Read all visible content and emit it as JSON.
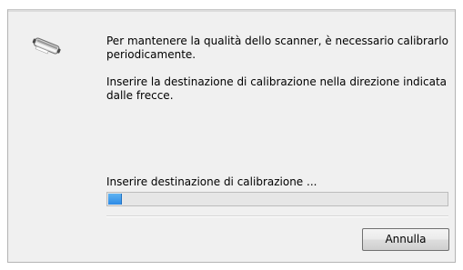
{
  "dialog": {
    "icon": "scanner-icon",
    "message_1": "Per mantenere la qualità dello scanner, è necessario calibrarlo periodicamente.",
    "message_2": "Inserire la destinazione di calibrazione nella direzione indicata dalle frecce.",
    "progress_label": "Inserire destinazione di calibrazione ...",
    "progress_fraction": 0.04,
    "progress_color": "#3390e8",
    "cancel_label": "Annulla"
  }
}
